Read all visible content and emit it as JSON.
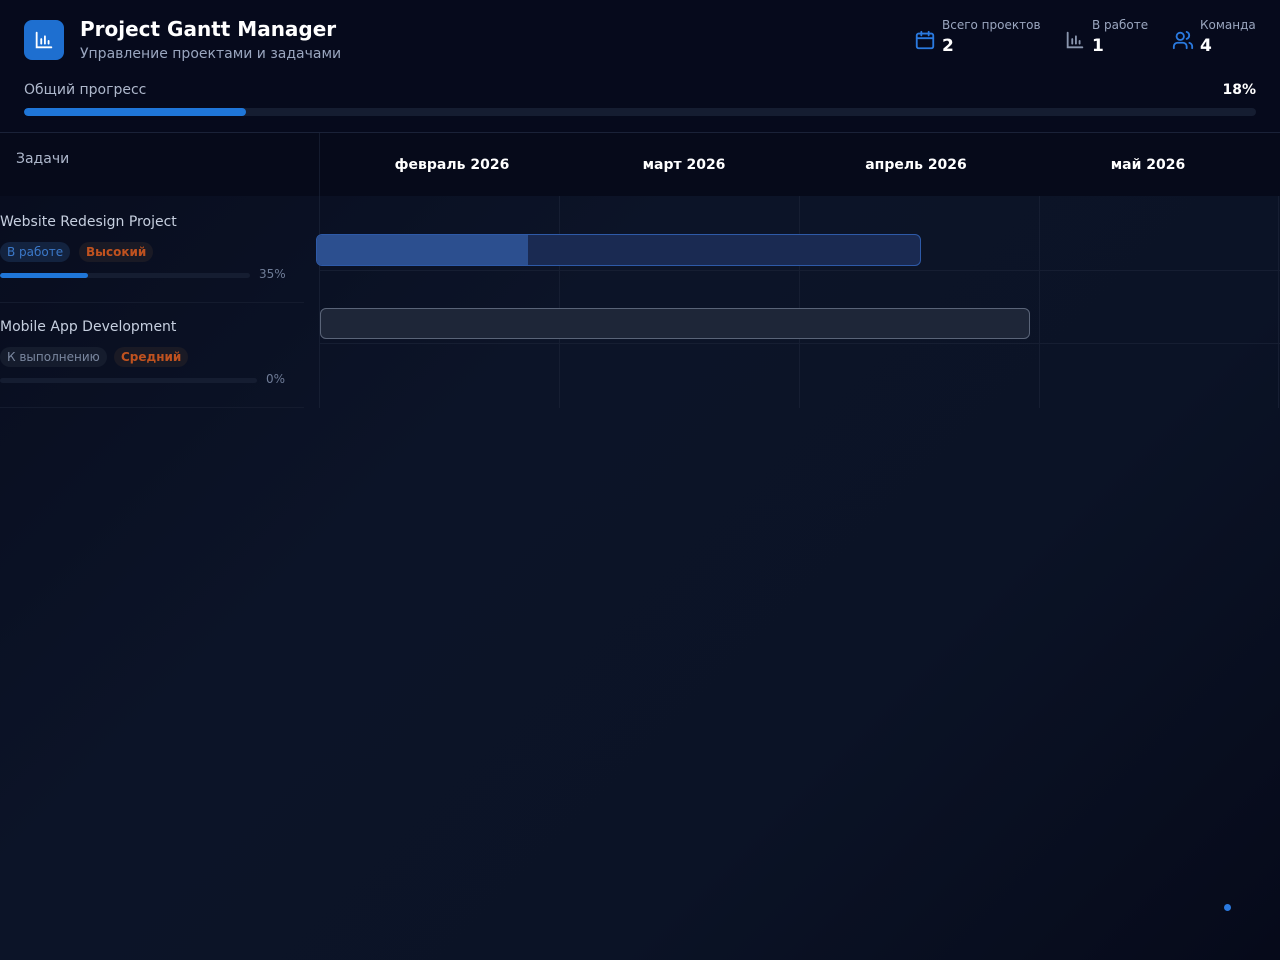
{
  "app": {
    "title": "Project Gantt Manager",
    "subtitle": "Управление проектами и задачами",
    "logo_icon": "bar-chart-icon",
    "accent_color": "#1e6fd0"
  },
  "stats": [
    {
      "icon": "calendar-icon",
      "label": "Всего проектов",
      "value": "2"
    },
    {
      "icon": "bar-chart-icon",
      "label": "В работе",
      "value": "1"
    },
    {
      "icon": "users-icon",
      "label": "Команда",
      "value": "4"
    }
  ],
  "overall_progress": {
    "label": "Общий прогресс",
    "percent_text": "18%",
    "value": 0.18
  },
  "gantt": {
    "tasks_header": "Задачи",
    "months": [
      "февраль 2026",
      "март 2026",
      "апрель 2026",
      "май 2026"
    ],
    "tasks": [
      {
        "name": "Website Redesign Project",
        "status": "В работе",
        "priority": "Высокий",
        "progress_text": "35%",
        "progress": 0.35,
        "status_color": "#3b78c8",
        "priority_color": "#c0521f"
      },
      {
        "name": "Mobile App Development",
        "status": "К выполнению",
        "priority": "Средний",
        "progress_text": "0%",
        "progress": 0.0,
        "status_color": "#7a879f",
        "priority_color": "#c0521f"
      }
    ]
  }
}
